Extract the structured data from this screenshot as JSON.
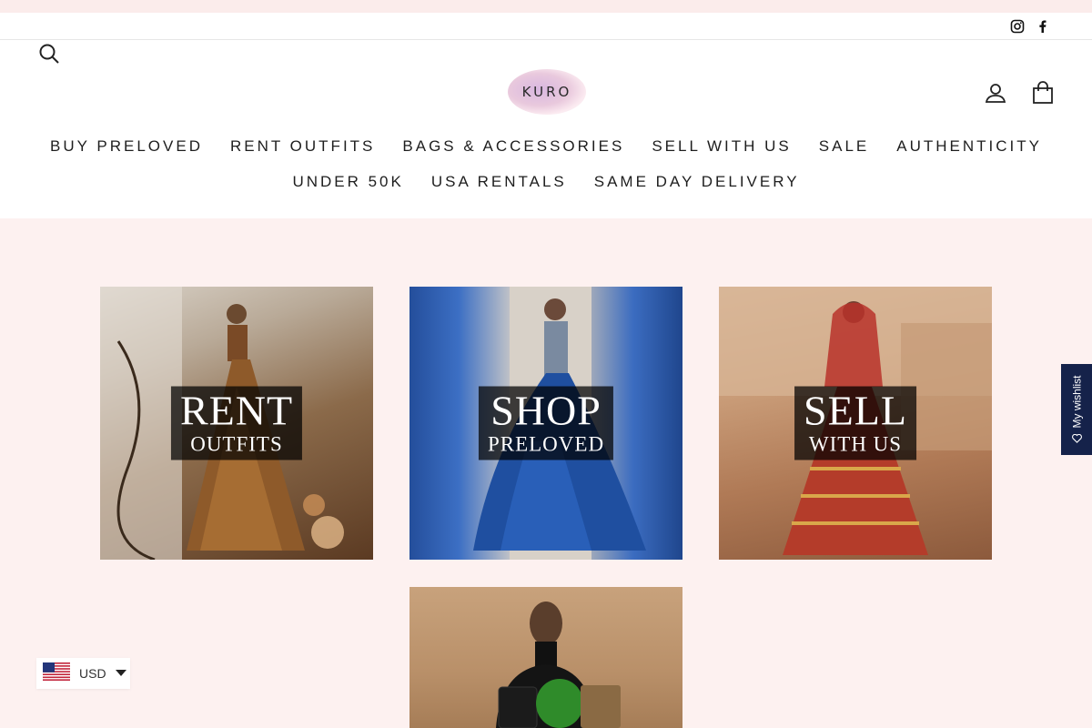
{
  "header": {
    "logo_text": "KURO",
    "icons": {
      "instagram": "instagram-icon",
      "facebook": "facebook-icon",
      "search": "search-icon",
      "account": "user-icon",
      "cart": "shopping-bag-icon"
    }
  },
  "nav": {
    "row1": [
      "BUY PRELOVED",
      "RENT OUTFITS",
      "BAGS & ACCESSORIES",
      "SELL WITH US",
      "SALE",
      "AUTHENTICITY"
    ],
    "row2": [
      "UNDER 50K",
      "USA RENTALS",
      "SAME DAY DELIVERY"
    ]
  },
  "tiles": {
    "rent": {
      "line1": "RENT",
      "line2": "OUTFITS"
    },
    "shop": {
      "line1": "SHOP",
      "line2": "PRELOVED"
    },
    "sell": {
      "line1": "SELL",
      "line2": "WITH US"
    }
  },
  "currency": {
    "code": "USD",
    "flag": "us-flag-icon"
  },
  "wishlist": {
    "label": "My wishlist"
  },
  "colors": {
    "page_bg": "#fdf1f0",
    "header_bg": "#ffffff",
    "text": "#1e1e1e",
    "wishlist_bg": "#15224a",
    "tile_overlay": "#000000"
  }
}
